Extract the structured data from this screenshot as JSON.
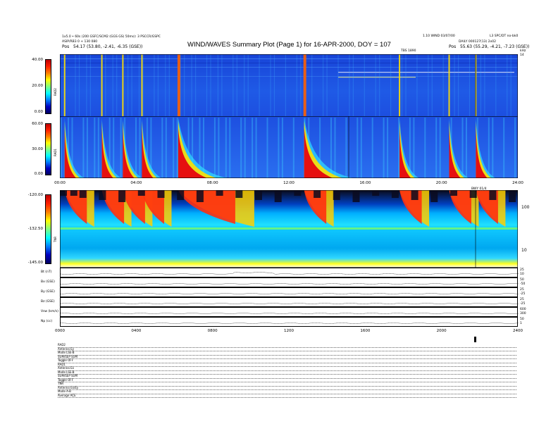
{
  "header": {
    "left_line1": "1x5.0 • 60s (200 GSFC/SCM2 (GGS GS) 50ms): 3 PSCCR/GSPC",
    "left_line2": "ASIP/RB3 0 + 130 080",
    "left_line3_label": "Pos",
    "left_line3_value": "54.17 (53.80, -2.41, -6.35 (GSE))",
    "title": "WIND/WAVES Summary Plot (Page 1) for 16-APR-2000, DOY = 107",
    "right_line1_a": "1.10 WIND 03/07/00",
    "right_line1_b": "L3 SPC/DT no-bk0",
    "right_line2": "DAILY 000127(13) 2x02",
    "right_line3_label": "Pos",
    "right_line3_value": "55.63 (55.29, -4.21, -7.23 (GSE))",
    "time_marker_top": "TBS 1890",
    "khz_label": "kHz"
  },
  "colors": {
    "spectrogram_background": "#1f50e0",
    "burst_core": "#e61010",
    "tnr_dark": "#0b0b1e"
  },
  "colorbar_rad2": {
    "label": "RAD2",
    "ticks": [
      "40.00",
      "20.00",
      "0.00"
    ],
    "range": [
      0,
      40
    ]
  },
  "colorbar_rad1": {
    "label": "RAD1",
    "ticks": [
      "60.00",
      "30.00",
      "0.00"
    ],
    "range": [
      0,
      60
    ]
  },
  "colorbar_tnr": {
    "label": "TNR",
    "ticks": [
      "-120.00",
      "-132.50",
      "-145.00"
    ],
    "range": [
      -145,
      -120
    ]
  },
  "time_axis_top": {
    "ticks": [
      "00:00",
      "04:00",
      "08:00",
      "12:00",
      "16:00",
      "20:00",
      "24:00"
    ],
    "event_label": "BWY 01/4"
  },
  "tnr_right_axis": {
    "ticks": [
      "100",
      "10"
    ]
  },
  "rad2_right_axis": {
    "top_tick": "14"
  },
  "time_series": [
    {
      "label": "Bt (nT)",
      "right_ticks": [
        "25",
        "10"
      ]
    },
    {
      "label": "Bx (GSE)",
      "right_ticks": [
        "50",
        "-50"
      ]
    },
    {
      "label": "By (GSE)",
      "right_ticks": [
        "25",
        "-25"
      ]
    },
    {
      "label": "Bz (GSE)",
      "right_ticks": [
        "25",
        "-25"
      ]
    },
    {
      "label": "Vsw (km/s)",
      "right_ticks": [
        "600",
        "300"
      ]
    },
    {
      "label": "Np (cc)",
      "right_ticks": [
        "50",
        "1"
      ]
    }
  ],
  "time_axis_bottom": {
    "ticks": [
      "0000",
      "0400",
      "0800",
      "1200",
      "1600",
      "2000",
      "2400"
    ]
  },
  "info_block": [
    "RAD2",
    "Antenna     Ey",
    "Mode    LSE-B",
    "SUM/SEP  SUM",
    "Toggle   OFF",
    "RAD1",
    "Antenna     Ex",
    "Mode   LSE-B",
    "SUM/SEP  SUM",
    "Toggle   OFF",
    "TNR",
    "Antenna   Ex/Ey",
    "Mode       A-B",
    "Average    ACE"
  ],
  "chart_data": {
    "type": "heatmap",
    "title": "WIND/WAVES Summary Plot (Page 1) for 16-APR-2000, DOY = 107",
    "x_range_hours": [
      0,
      24
    ],
    "panels": [
      {
        "name": "RAD2",
        "colorbar_range": [
          0,
          40
        ]
      },
      {
        "name": "RAD1",
        "colorbar_range": [
          0,
          60
        ]
      },
      {
        "name": "TNR",
        "colorbar_range": [
          -145,
          -120
        ]
      }
    ],
    "burst_times_hours": [
      0.25,
      2.2,
      3.3,
      4.3,
      6.2,
      12.8,
      17.8,
      20.4,
      21.8
    ],
    "vertical_markers_hours": [
      15.2,
      22.1
    ]
  }
}
